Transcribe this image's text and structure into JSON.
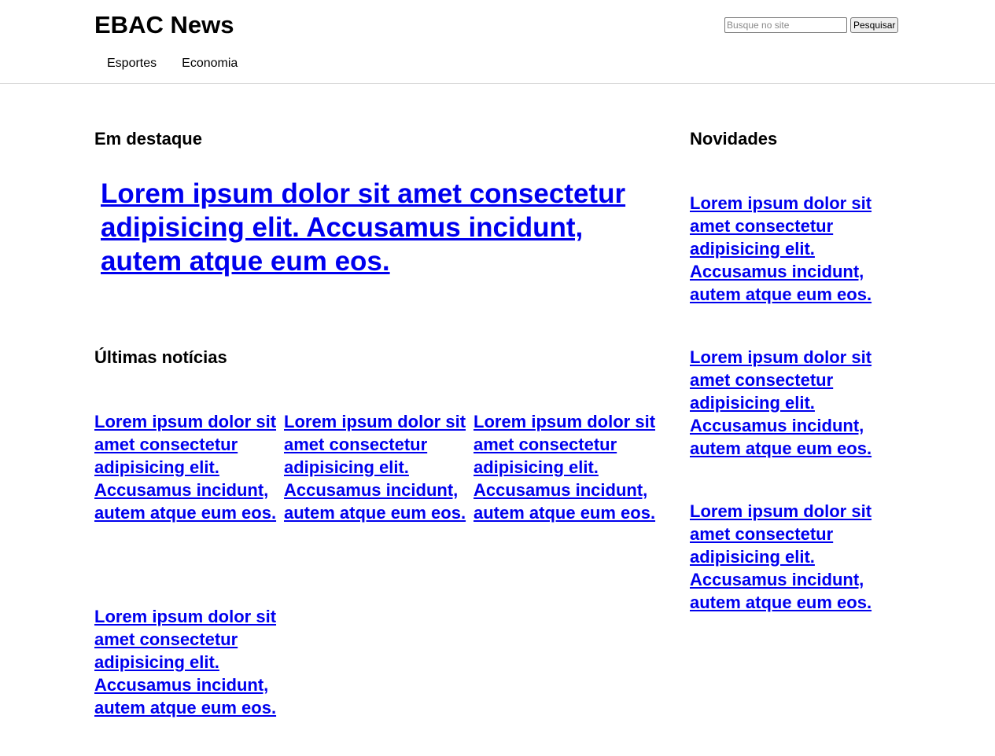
{
  "header": {
    "logo": "EBAC News",
    "search_placeholder": "Busque no site",
    "search_button": "Pesquisar",
    "nav": [
      "Esportes",
      "Economia"
    ]
  },
  "featured": {
    "title": "Em destaque",
    "headline": "Lorem ipsum dolor sit amet consectetur adipisicing elit. Accusamus incidunt, autem atque eum eos."
  },
  "latest": {
    "title": "Últimas notícias",
    "items": [
      "Lorem ipsum dolor sit amet consectetur adipisicing elit. Accusamus incidunt, autem atque eum eos.",
      "Lorem ipsum dolor sit amet consectetur adipisicing elit. Accusamus incidunt, autem atque eum eos.",
      "Lorem ipsum dolor sit amet consectetur adipisicing elit. Accusamus incidunt, autem atque eum eos.",
      "Lorem ipsum dolor sit amet consectetur adipisicing elit. Accusamus incidunt, autem atque eum eos."
    ]
  },
  "news": {
    "title": "Novidades",
    "items": [
      "Lorem ipsum dolor sit amet consectetur adipisicing elit. Accusamus incidunt, autem atque eum eos.",
      "Lorem ipsum dolor sit amet consectetur adipisicing elit. Accusamus incidunt, autem atque eum eos.",
      "Lorem ipsum dolor sit amet consectetur adipisicing elit. Accusamus incidunt, autem atque eum eos."
    ]
  },
  "colors": {
    "link": "#0000ee",
    "text": "#000000",
    "divider": "#cfcfcf"
  }
}
